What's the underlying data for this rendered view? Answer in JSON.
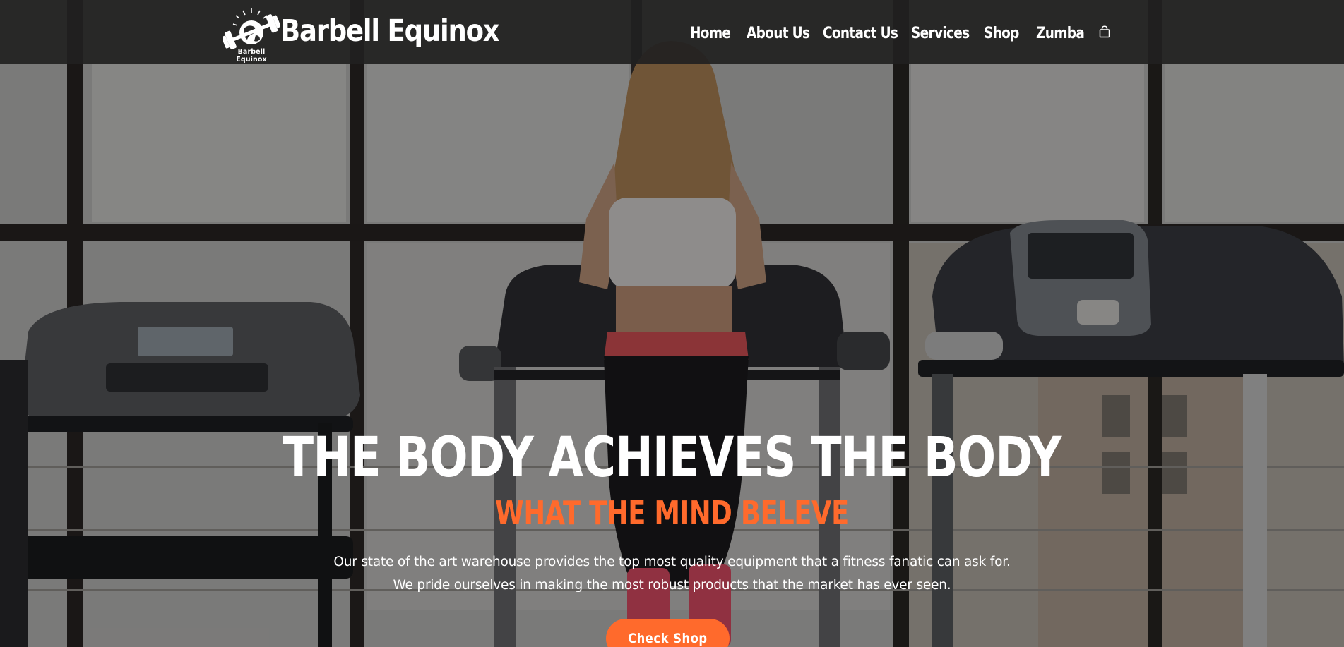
{
  "header": {
    "logo_caption": "Barbell Equinox",
    "site_title": "Barbell Equinox",
    "nav": [
      {
        "label": "Home"
      },
      {
        "label": "About Us"
      },
      {
        "label": "Contact Us"
      },
      {
        "label": "Services"
      },
      {
        "label": "Shop"
      },
      {
        "label": "Zumba"
      }
    ],
    "cart_icon": "shopping-bag-icon"
  },
  "hero": {
    "title": "THE BODY ACHIEVES THE BODY",
    "subtitle": "WHAT THE MIND BELEVE",
    "description_lines": [
      "Our state of the art warehouse provides the top most quality equipment that a fitness fanatic can ask for.",
      "We pride ourselves in making the most robust products that the market has ever seen."
    ],
    "cta_label": "Check Shop"
  },
  "colors": {
    "accent": "#ff6a2c",
    "header_bg": "#212121",
    "text": "#ffffff"
  }
}
